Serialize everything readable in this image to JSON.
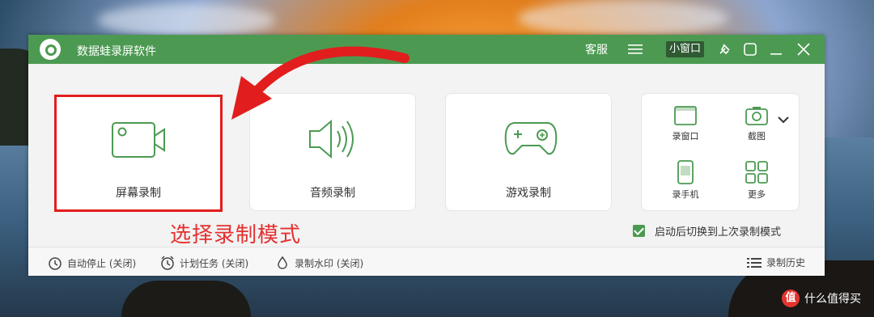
{
  "app": {
    "title": "数据蛙录屏软件"
  },
  "titlebar": {
    "service": "客服",
    "mini_window": "小窗口"
  },
  "modes": [
    {
      "label": "屏幕录制",
      "icon": "camera-icon"
    },
    {
      "label": "音频录制",
      "icon": "speaker-icon"
    },
    {
      "label": "游戏录制",
      "icon": "gamepad-icon"
    }
  ],
  "tools": [
    {
      "label": "录窗口",
      "icon": "window-icon"
    },
    {
      "label": "截图",
      "icon": "screenshot-icon"
    },
    {
      "label": "录手机",
      "icon": "phone-icon"
    },
    {
      "label": "更多",
      "icon": "grid-icon"
    }
  ],
  "annotation": "选择录制模式",
  "checkbox": {
    "label": "启动后切换到上次录制模式",
    "checked": true
  },
  "bottom": {
    "auto_stop": "自动停止 (关闭)",
    "schedule": "计划任务 (关闭)",
    "watermark": "录制水印 (关闭)",
    "history": "录制历史"
  },
  "watermark_text": "什么值得买",
  "watermark_badge": "值",
  "colors": {
    "accent": "#4c9a52",
    "highlight": "#e21d1d"
  }
}
